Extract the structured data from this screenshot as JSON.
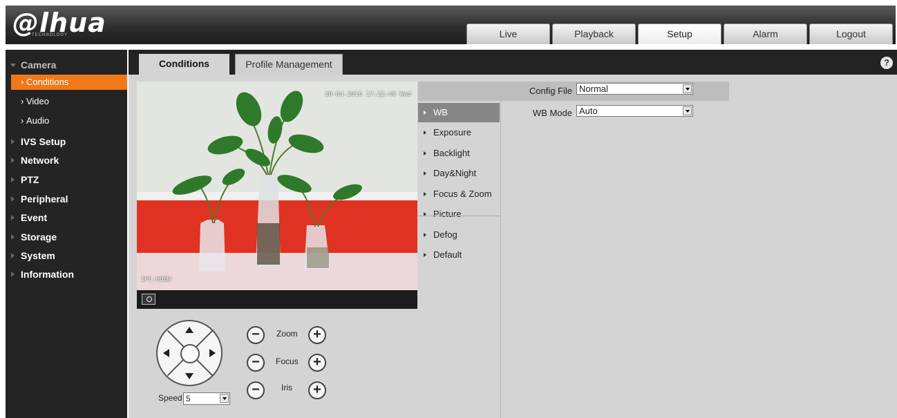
{
  "header": {
    "logo": "@lhua",
    "logo_sub": "TECHNOLOGY",
    "nav": [
      {
        "label": "Live"
      },
      {
        "label": "Playback"
      },
      {
        "label": "Setup",
        "active": true
      },
      {
        "label": "Alarm"
      },
      {
        "label": "Logout"
      }
    ]
  },
  "sidebar": {
    "camera": "Camera",
    "camera_sub": [
      {
        "label": "Conditions",
        "active": true
      },
      {
        "label": "Video"
      },
      {
        "label": "Audio"
      }
    ],
    "items": [
      "IVS Setup",
      "Network",
      "PTZ",
      "Peripheral",
      "Event",
      "Storage",
      "System",
      "Information"
    ]
  },
  "content": {
    "tabs": [
      "Conditions",
      "Profile Management"
    ],
    "active_tab": "Conditions",
    "help": "?"
  },
  "video": {
    "osd_time": "20-04-2016 17:22:40 Wed",
    "osd_name": "IPC-HDBW"
  },
  "ptz": {
    "zoom_label": "Zoom",
    "focus_label": "Focus",
    "iris_label": "Iris",
    "minus": "−",
    "plus": "+",
    "speed_label": "Speed",
    "speed_value": "5"
  },
  "submenu": [
    "WB",
    "Exposure",
    "Backlight",
    "Day&Night",
    "Focus & Zoom",
    "Picture",
    "Defog",
    "Default"
  ],
  "submenu_active": "WB",
  "config": {
    "config_file_label": "Config File",
    "config_file_value": "Normal",
    "wb_mode_label": "WB Mode",
    "wb_mode_value": "Auto"
  },
  "colors": {
    "accent": "#f07818",
    "header_bg": "#2e2e2e",
    "sidebar_bg": "#242424",
    "panel_bg": "#d4d4d4"
  }
}
